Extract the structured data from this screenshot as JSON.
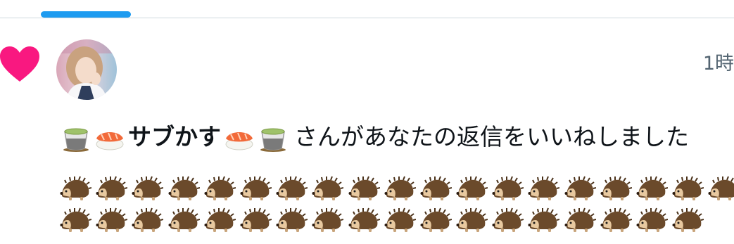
{
  "tabs": {
    "active_indicator_color": "#1d9bf0"
  },
  "notification": {
    "icon": "heart-icon",
    "icon_color": "#f91880",
    "timestamp": "1時",
    "display_name": "サブかす",
    "name_prefix_emoji": [
      "green-tea-emoji",
      "sushi-emoji"
    ],
    "name_suffix_emoji": [
      "sushi-emoji",
      "green-tea-emoji"
    ],
    "action_text": "さんがあなたの返信をいいねしました",
    "reply_preview_emoji": {
      "name": "hedgehog-emoji",
      "row1_count": 19,
      "row2_count": 18
    }
  }
}
